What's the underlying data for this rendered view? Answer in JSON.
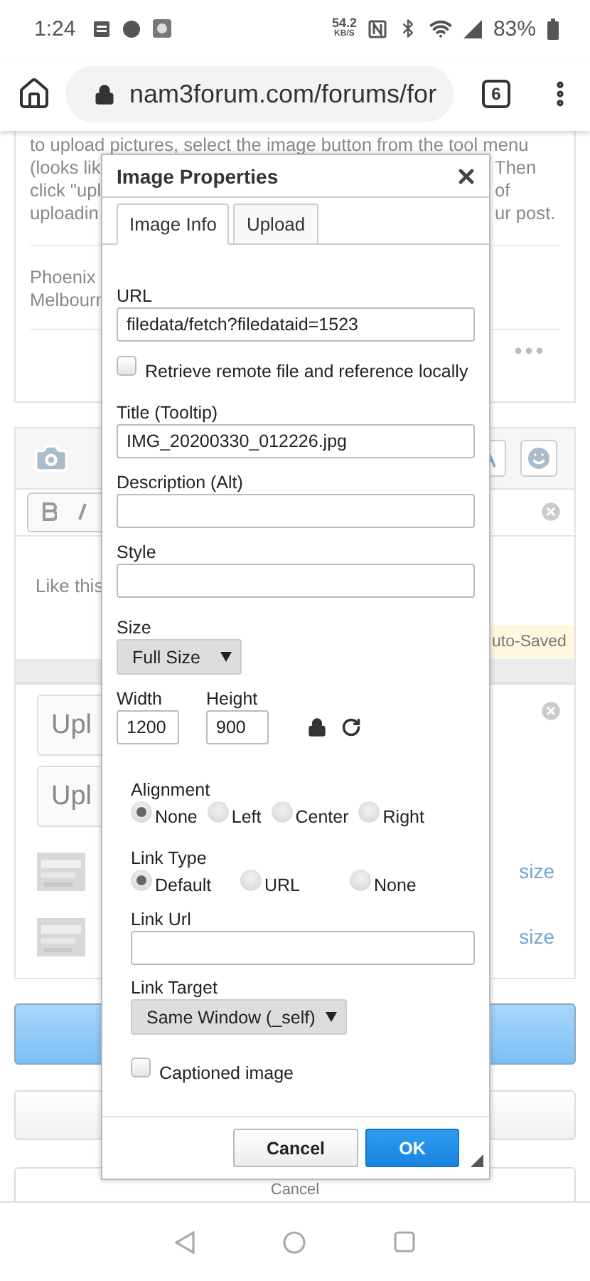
{
  "status_bar": {
    "time": "1:24",
    "speed": "54.2",
    "speed_unit": "KB/S",
    "battery": "83%"
  },
  "browser": {
    "url": "nam3forum.com/forums/for",
    "tab_count": "6"
  },
  "post": {
    "lines": [
      {
        "left": "to upload pictures, select the image button from the tool menu"
      },
      {
        "left": "(looks lik",
        "right": "Then"
      },
      {
        "left": "click \"upl",
        "right": "of"
      },
      {
        "left": "uploadin",
        "right": "ur post."
      }
    ],
    "signature": [
      "Phoenix",
      "Melbourn"
    ]
  },
  "editor": {
    "text": "Like this",
    "autosave": "uto-Saved"
  },
  "uploads": {
    "fields": [
      "Upl",
      "Upl"
    ],
    "files": [
      {
        "link": "size"
      },
      {
        "link": "size"
      }
    ]
  },
  "page_buttons": {
    "cancel": "Cancel"
  },
  "dialog": {
    "title": "Image Properties",
    "tabs": [
      {
        "label": "Image Info",
        "selected": true
      },
      {
        "label": "Upload",
        "selected": false
      }
    ],
    "url": {
      "label": "URL",
      "value": "filedata/fetch?filedataid=1523"
    },
    "retrieve": {
      "label": "Retrieve remote file and reference locally",
      "checked": false
    },
    "title_field": {
      "label": "Title (Tooltip)",
      "value": "IMG_20200330_012226.jpg"
    },
    "description": {
      "label": "Description (Alt)"
    },
    "style": {
      "label": "Style"
    },
    "size": {
      "label": "Size",
      "value": "Full Size"
    },
    "width": {
      "label": "Width",
      "value": "1200"
    },
    "height": {
      "label": "Height",
      "value": "900"
    },
    "alignment": {
      "label": "Alignment",
      "options": [
        {
          "label": "None",
          "selected": true
        },
        {
          "label": "Left",
          "selected": false
        },
        {
          "label": "Center",
          "selected": false
        },
        {
          "label": "Right",
          "selected": false
        }
      ]
    },
    "link_type": {
      "label": "Link Type",
      "options": [
        {
          "label": "Default",
          "selected": true
        },
        {
          "label": "URL",
          "selected": false
        },
        {
          "label": "None",
          "selected": false
        }
      ]
    },
    "link_url": {
      "label": "Link Url"
    },
    "link_target": {
      "label": "Link Target",
      "value": "Same Window (_self)"
    },
    "captioned": {
      "label": "Captioned image",
      "checked": false
    },
    "buttons": {
      "cancel": "Cancel",
      "ok": "OK"
    }
  }
}
